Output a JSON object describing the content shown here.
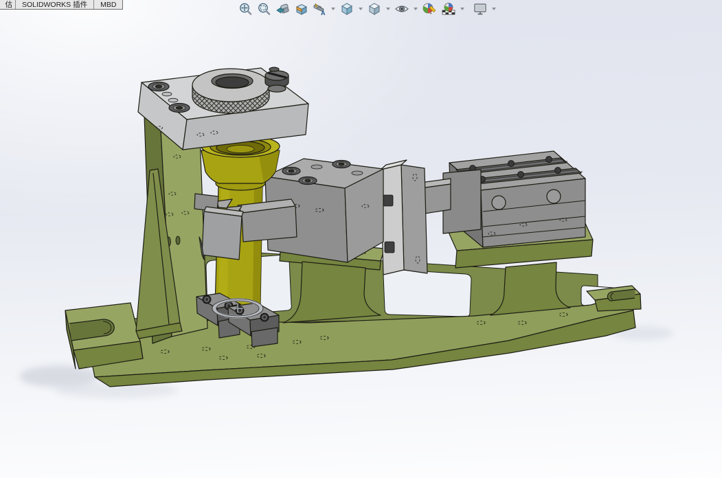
{
  "command_manager": {
    "tabs": [
      {
        "label": "估",
        "clipped": true
      },
      {
        "label": "SOLIDWORKS 插件",
        "clipped": false
      },
      {
        "label": "MBD",
        "clipped": false
      }
    ]
  },
  "heads_up_toolbar": {
    "buttons": [
      {
        "name": "zoom-to-fit"
      },
      {
        "name": "zoom-to-area"
      },
      {
        "name": "previous-view"
      },
      {
        "name": "section-view"
      },
      {
        "name": "dynamic-annotation-views",
        "has_dropdown": true
      },
      {
        "name": "view-orientation",
        "has_dropdown": true
      },
      {
        "name": "display-style",
        "has_dropdown": true
      },
      {
        "name": "hide-show-items",
        "has_dropdown": true
      },
      {
        "name": "edit-appearance"
      },
      {
        "name": "apply-scene",
        "has_dropdown": true
      },
      {
        "name": "view-settings",
        "has_dropdown": true
      }
    ]
  },
  "viewport": {
    "selection_marker": {
      "shape": "circle-with-crosshair"
    },
    "model_parts": [
      {
        "name": "fixture-base-plate",
        "color": "#8f9e5a"
      },
      {
        "name": "vertical-support-column",
        "color": "#8b9a55"
      },
      {
        "name": "gusset-rib",
        "color": "#7f8e4a"
      },
      {
        "name": "top-clamp-plate",
        "color": "#d3d4d5"
      },
      {
        "name": "knurled-hand-knob",
        "color": "#c4c4c4"
      },
      {
        "name": "slotted-thumb-screw",
        "color": "#4e4e4e"
      },
      {
        "name": "locating-bushing",
        "color": "#a8a312"
      },
      {
        "name": "slide-block",
        "color": "#ababab"
      },
      {
        "name": "coupling-flange-plates",
        "color": "#cdcdcd"
      },
      {
        "name": "piston-rod",
        "color": "#969696"
      },
      {
        "name": "pneumatic-slide-cylinder",
        "color": "#8e8e8e"
      },
      {
        "name": "clamp-jaw-blocks",
        "color": "#5c5c5c"
      }
    ]
  },
  "colors": {
    "bg-top": "#e1e4ee",
    "bg-bottom": "#fdfdfe",
    "green-top": "#8f9e5a",
    "green-top2": "#97a563",
    "green-front": "#76853f",
    "green-side": "#67753a",
    "green-web": "#7c8b49",
    "outline": "#1d1d15",
    "window-fill": "#edf0f5",
    "plate-top": "#d3d4d5",
    "plate-front": "#b9babb",
    "plate-side": "#c6c7c8",
    "block-top": "#ababab",
    "block-front": "#8f8f8f",
    "block-side": "#9b9b9b",
    "cylblock-top": "#a2a2a2",
    "cylblock-front": "#8e8e8e",
    "cylblock-side": "#767676",
    "flange-bright": "#cdcdcd",
    "flange-dark": "#9e9e9e",
    "rod-top": "#b8b8b8",
    "rod-front": "#969696",
    "yellow-top": "#b9b31d",
    "yellow-body": "#a8a312",
    "yellow-dark": "#8f8a0d",
    "knurl-face": "#c4c4c4",
    "knurl-band": "#b0b0b0",
    "knob-dark": "#4e4e4e",
    "clamp-top": "#8f8f8f",
    "clamp-front": "#5c5c5c",
    "ring-gray": "#b5b8bc"
  }
}
